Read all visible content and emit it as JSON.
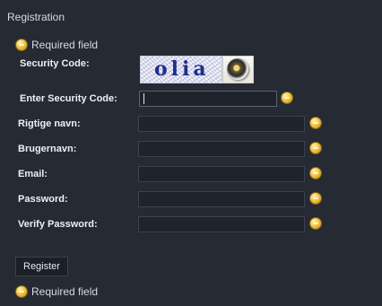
{
  "page": {
    "title": "Registration",
    "required_note": "Required field",
    "register_label": "Register"
  },
  "captcha": {
    "label": "Security Code:",
    "code_text": "olia",
    "audio_icon": "speaker-icon"
  },
  "fields": {
    "security_code": {
      "label": "Enter Security Code:",
      "value": ""
    },
    "real_name": {
      "label": "Rigtige navn:",
      "value": ""
    },
    "username": {
      "label": "Brugernavn:",
      "value": ""
    },
    "email": {
      "label": "Email:",
      "value": ""
    },
    "password": {
      "label": "Password:",
      "value": ""
    },
    "verify_password": {
      "label": "Verify Password:",
      "value": ""
    }
  },
  "icons": {
    "required": "required-marker-icon"
  },
  "colors": {
    "background": "#252a33",
    "input_background": "#1f232b",
    "input_border": "#3b4250",
    "required_marker": "#f3c44a",
    "captcha_text": "#1f2f8a"
  }
}
